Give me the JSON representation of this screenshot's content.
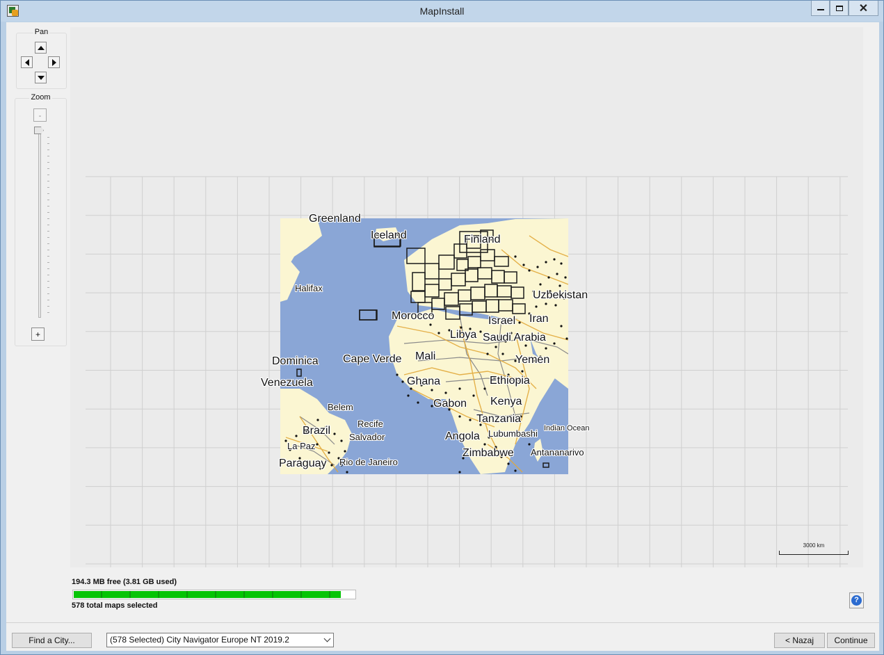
{
  "window": {
    "title": "MapInstall"
  },
  "controls": {
    "pan_label": "Pan",
    "zoom_label": "Zoom",
    "zoom_out_label": "-",
    "zoom_in_label": "+"
  },
  "map": {
    "scale_label": "3000 km",
    "labels": [
      "Greenland",
      "Iceland",
      "Finland",
      "Uzbekistan",
      "Morocco",
      "Israel",
      "Iran",
      "Libya",
      "Saudi Arabia",
      "Halifax",
      "Dominica",
      "Cape Verde",
      "Mali",
      "Yemen",
      "Venezuela",
      "Ghana",
      "Ethiopia",
      "Gabon",
      "Kenya",
      "Belem",
      "Tanzania",
      "Brazil",
      "Recife",
      "Salvador",
      "Angola",
      "Lubumbashi",
      "Indian Ocean",
      "La Paz",
      "Zimbabwe",
      "Antananarivo",
      "Paraguay",
      "Rio de Janeiro"
    ],
    "colors": {
      "ocean": "#8aa6d6",
      "land": "#fbf6d2",
      "roads": "#e2a93a",
      "borders": "#8a8a8a",
      "tiles": "#1a1a1a"
    }
  },
  "status": {
    "storage_text": "194.3 MB free (3.81 GB used)",
    "usage_fraction": 0.95,
    "maps_selected_text": "578 total maps selected"
  },
  "footer": {
    "find_city_label": "Find a City...",
    "product_select_value": "(578 Selected) City Navigator Europe NT 2019.2",
    "back_label": "< Nazaj",
    "continue_label": "Continue"
  }
}
